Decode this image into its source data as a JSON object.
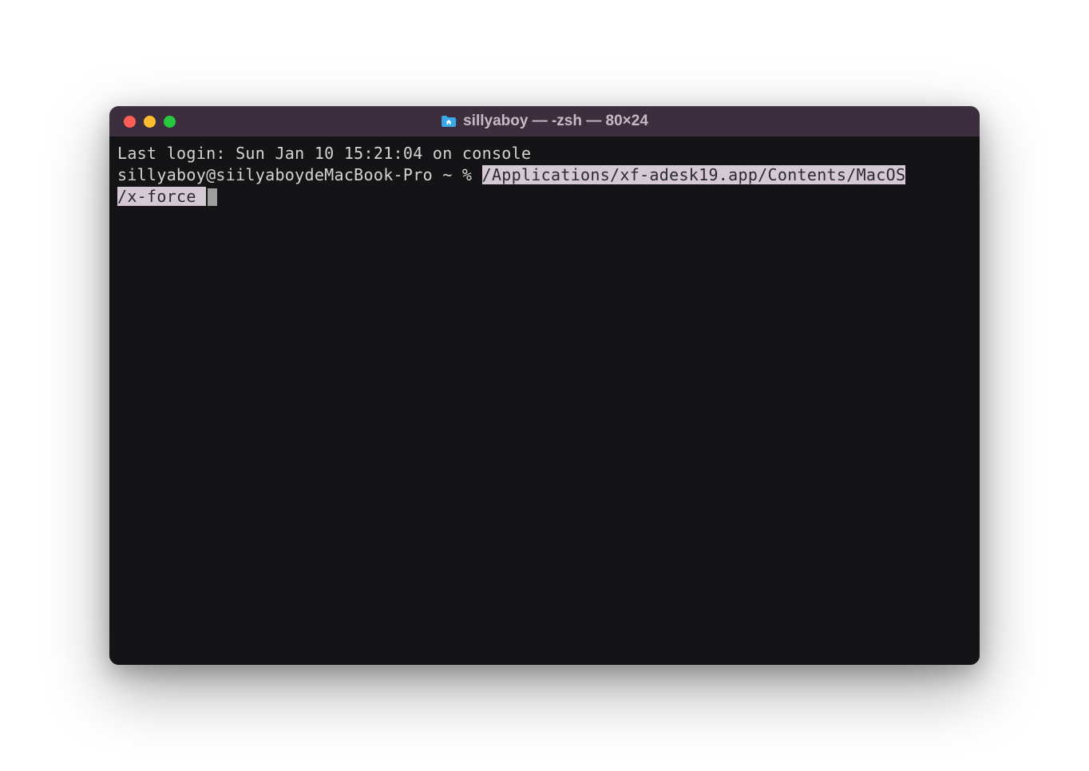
{
  "window": {
    "title": "sillyaboy — -zsh — 80×24",
    "folder_icon": "folder-home-icon"
  },
  "traffic_lights": {
    "close": "close",
    "minimize": "minimize",
    "zoom": "zoom"
  },
  "terminal": {
    "last_login": "Last login: Sun Jan 10 15:21:04 on console",
    "prompt": "sillyaboy@siilyaboydeMacBook-Pro ~ % ",
    "command_line1": "/Applications/xf-adesk19.app/Contents/MacOS",
    "command_line2": "/x-force "
  },
  "colors": {
    "window_bg": "#141417",
    "titlebar_bg": "#3d2e3e",
    "text": "#d4d4d4",
    "highlight_bg": "#d4c9d4",
    "highlight_text": "#2a2a2e"
  }
}
